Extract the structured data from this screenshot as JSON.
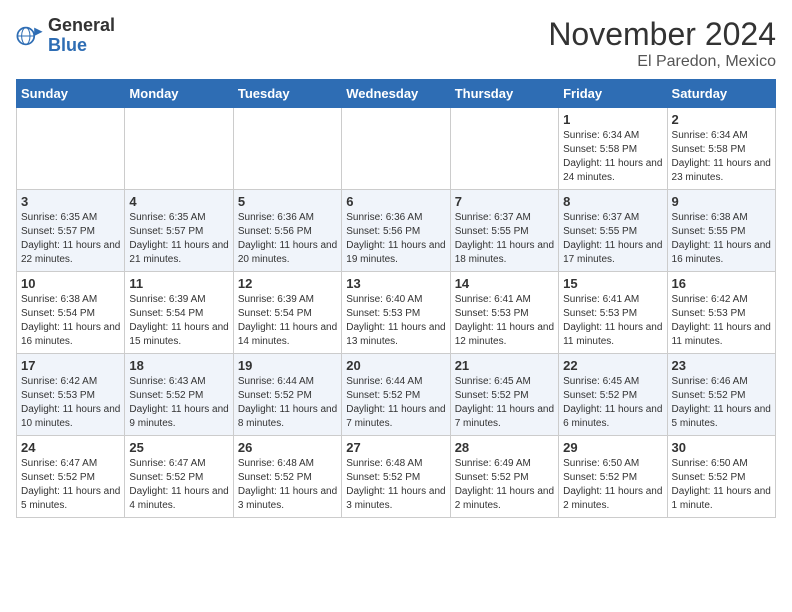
{
  "header": {
    "logo_general": "General",
    "logo_blue": "Blue",
    "month_title": "November 2024",
    "location": "El Paredon, Mexico"
  },
  "weekdays": [
    "Sunday",
    "Monday",
    "Tuesday",
    "Wednesday",
    "Thursday",
    "Friday",
    "Saturday"
  ],
  "weeks": [
    [
      {
        "day": "",
        "info": ""
      },
      {
        "day": "",
        "info": ""
      },
      {
        "day": "",
        "info": ""
      },
      {
        "day": "",
        "info": ""
      },
      {
        "day": "",
        "info": ""
      },
      {
        "day": "1",
        "info": "Sunrise: 6:34 AM\nSunset: 5:58 PM\nDaylight: 11 hours and 24 minutes."
      },
      {
        "day": "2",
        "info": "Sunrise: 6:34 AM\nSunset: 5:58 PM\nDaylight: 11 hours and 23 minutes."
      }
    ],
    [
      {
        "day": "3",
        "info": "Sunrise: 6:35 AM\nSunset: 5:57 PM\nDaylight: 11 hours and 22 minutes."
      },
      {
        "day": "4",
        "info": "Sunrise: 6:35 AM\nSunset: 5:57 PM\nDaylight: 11 hours and 21 minutes."
      },
      {
        "day": "5",
        "info": "Sunrise: 6:36 AM\nSunset: 5:56 PM\nDaylight: 11 hours and 20 minutes."
      },
      {
        "day": "6",
        "info": "Sunrise: 6:36 AM\nSunset: 5:56 PM\nDaylight: 11 hours and 19 minutes."
      },
      {
        "day": "7",
        "info": "Sunrise: 6:37 AM\nSunset: 5:55 PM\nDaylight: 11 hours and 18 minutes."
      },
      {
        "day": "8",
        "info": "Sunrise: 6:37 AM\nSunset: 5:55 PM\nDaylight: 11 hours and 17 minutes."
      },
      {
        "day": "9",
        "info": "Sunrise: 6:38 AM\nSunset: 5:55 PM\nDaylight: 11 hours and 16 minutes."
      }
    ],
    [
      {
        "day": "10",
        "info": "Sunrise: 6:38 AM\nSunset: 5:54 PM\nDaylight: 11 hours and 16 minutes."
      },
      {
        "day": "11",
        "info": "Sunrise: 6:39 AM\nSunset: 5:54 PM\nDaylight: 11 hours and 15 minutes."
      },
      {
        "day": "12",
        "info": "Sunrise: 6:39 AM\nSunset: 5:54 PM\nDaylight: 11 hours and 14 minutes."
      },
      {
        "day": "13",
        "info": "Sunrise: 6:40 AM\nSunset: 5:53 PM\nDaylight: 11 hours and 13 minutes."
      },
      {
        "day": "14",
        "info": "Sunrise: 6:41 AM\nSunset: 5:53 PM\nDaylight: 11 hours and 12 minutes."
      },
      {
        "day": "15",
        "info": "Sunrise: 6:41 AM\nSunset: 5:53 PM\nDaylight: 11 hours and 11 minutes."
      },
      {
        "day": "16",
        "info": "Sunrise: 6:42 AM\nSunset: 5:53 PM\nDaylight: 11 hours and 11 minutes."
      }
    ],
    [
      {
        "day": "17",
        "info": "Sunrise: 6:42 AM\nSunset: 5:53 PM\nDaylight: 11 hours and 10 minutes."
      },
      {
        "day": "18",
        "info": "Sunrise: 6:43 AM\nSunset: 5:52 PM\nDaylight: 11 hours and 9 minutes."
      },
      {
        "day": "19",
        "info": "Sunrise: 6:44 AM\nSunset: 5:52 PM\nDaylight: 11 hours and 8 minutes."
      },
      {
        "day": "20",
        "info": "Sunrise: 6:44 AM\nSunset: 5:52 PM\nDaylight: 11 hours and 7 minutes."
      },
      {
        "day": "21",
        "info": "Sunrise: 6:45 AM\nSunset: 5:52 PM\nDaylight: 11 hours and 7 minutes."
      },
      {
        "day": "22",
        "info": "Sunrise: 6:45 AM\nSunset: 5:52 PM\nDaylight: 11 hours and 6 minutes."
      },
      {
        "day": "23",
        "info": "Sunrise: 6:46 AM\nSunset: 5:52 PM\nDaylight: 11 hours and 5 minutes."
      }
    ],
    [
      {
        "day": "24",
        "info": "Sunrise: 6:47 AM\nSunset: 5:52 PM\nDaylight: 11 hours and 5 minutes."
      },
      {
        "day": "25",
        "info": "Sunrise: 6:47 AM\nSunset: 5:52 PM\nDaylight: 11 hours and 4 minutes."
      },
      {
        "day": "26",
        "info": "Sunrise: 6:48 AM\nSunset: 5:52 PM\nDaylight: 11 hours and 3 minutes."
      },
      {
        "day": "27",
        "info": "Sunrise: 6:48 AM\nSunset: 5:52 PM\nDaylight: 11 hours and 3 minutes."
      },
      {
        "day": "28",
        "info": "Sunrise: 6:49 AM\nSunset: 5:52 PM\nDaylight: 11 hours and 2 minutes."
      },
      {
        "day": "29",
        "info": "Sunrise: 6:50 AM\nSunset: 5:52 PM\nDaylight: 11 hours and 2 minutes."
      },
      {
        "day": "30",
        "info": "Sunrise: 6:50 AM\nSunset: 5:52 PM\nDaylight: 11 hours and 1 minute."
      }
    ]
  ]
}
